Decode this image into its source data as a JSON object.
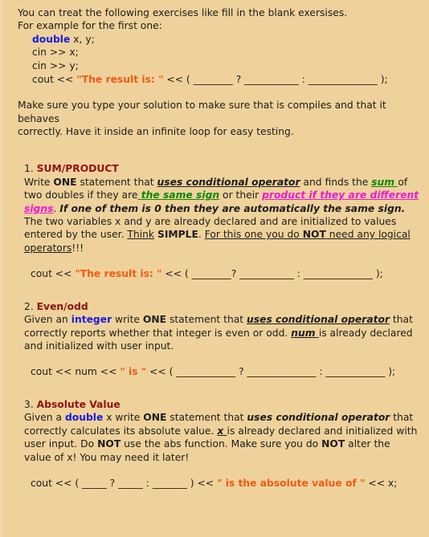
{
  "document": {
    "background_color": "#efd29b",
    "intro": {
      "line1": "You can treat the following exercises like fill in the blank exersises.",
      "line2": "For example for the first one:",
      "code": {
        "line1_kw": "double",
        "line1_rest": " x, y;",
        "line2": "cin >> x;",
        "line3": "cin >> y;",
        "line4_pre": "cout << ",
        "line4_str": "\"The result is: \"",
        "line4_post": " << ( ________ ? ___________ : ______________ );"
      }
    },
    "note": {
      "line1": "Make sure you type your solution to make sure that is compiles and that it behaves",
      "line2": "correctly. Have it inside an infinite loop for easy testing."
    },
    "exercises": [
      {
        "number": "1.",
        "title": "SUM/PRODUCT",
        "body": {
          "t1": "Write ",
          "b1": "ONE",
          "t2": " statement that ",
          "biu1": "uses conditional operator",
          "t3": " and finds the ",
          "green1": "sum ",
          "t4": "of two doubles if they are",
          "green2": " the same sign",
          "t5": " or their ",
          "magenta1": "product if they are different signs",
          "t6": ". ",
          "bi1": "If one of them is 0 then they are automatically the same sign.",
          "t7": " The two variables x and y are already declared and are initialized to values entered by the user. ",
          "u1": "Think",
          "t8": " ",
          "b2": "SIMPLE",
          "t9": ". ",
          "u2a": "For this one you do ",
          "u2b": "NOT",
          "u2c": " need any logical operators",
          "t10": "!!!"
        },
        "code": {
          "pre": "cout << ",
          "str": "\"The result is: \"",
          "post": " << ( ________? ___________ : ______________ );"
        }
      },
      {
        "number": "2.",
        "title": "Even/odd",
        "body": {
          "t1": "Given an ",
          "kw1": "integer",
          "t2": " write ",
          "b1": "ONE",
          "t3": " statement that ",
          "biu1": "uses conditional operator",
          "t4": " that correctly reports whether that integer is even or odd. ",
          "biu2": "num ",
          "t5": "is already declared and initialized with user input."
        },
        "code": {
          "pre": "cout << num << ",
          "str": "\" is \"",
          "post": " << ( ____________ ? ______________ : ____________ );"
        }
      },
      {
        "number": "3.",
        "title": "Absolute Value",
        "body": {
          "t1": "Given a ",
          "kw1": "double",
          "t2": " x write ",
          "b1": "ONE",
          "t3": " statement that ",
          "bi1": "uses conditional operator",
          "t4": " that correctly calculates its absolute value. ",
          "biu1": "x ",
          "t5": "is already declared and initialized with user input. Do ",
          "b2": "NOT",
          "t6": " use the abs function. Make sure you do ",
          "b3": "NOT",
          "t7": " alter the value of x! You may need it later!"
        },
        "code": {
          "pre": "cout << ( _____ ? _____ : _______ ) << ",
          "str": "\" is the absolute value of \"",
          "post": " << x;"
        }
      }
    ]
  }
}
